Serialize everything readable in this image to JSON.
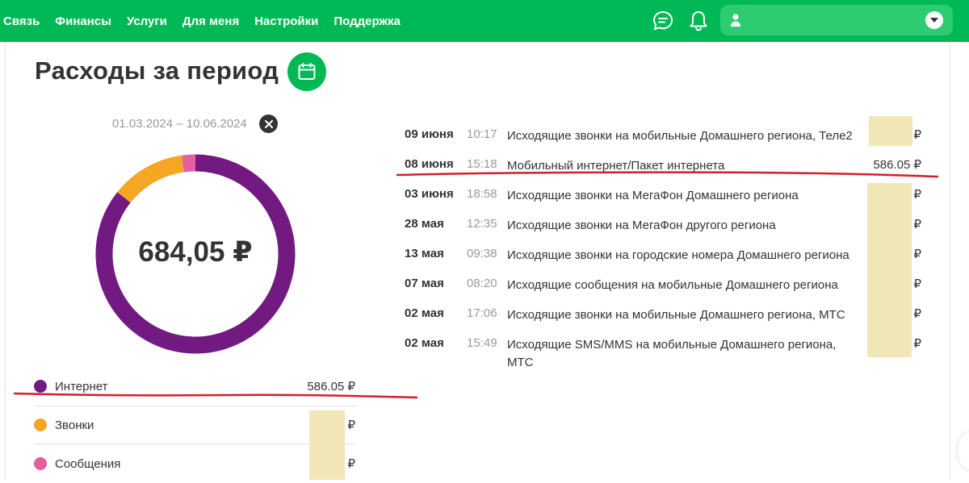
{
  "nav": {
    "items": [
      "Связь",
      "Финансы",
      "Услуги",
      "Для меня",
      "Настройки",
      "Поддержка"
    ]
  },
  "header": {
    "icons": [
      "chat-icon",
      "bell-icon",
      "user-icon",
      "chevron-down-icon"
    ]
  },
  "page": {
    "title": "Расходы за период",
    "period": "01.03.2024 – 10.06.2024"
  },
  "summary": {
    "total": "684,05 ₽",
    "legend": [
      {
        "label": "Интернет",
        "amount": "586.05 ₽",
        "color": "#731982"
      },
      {
        "label": "Звонки",
        "amount": "₽",
        "color": "#f5a623"
      },
      {
        "label": "Сообщения",
        "amount": "₽",
        "color": "#e55ea2"
      }
    ]
  },
  "chart_data": {
    "type": "pie",
    "categories": [
      "Интернет",
      "Звонки",
      "Сообщения"
    ],
    "values": [
      586.05,
      83.0,
      15.0
    ],
    "colors": [
      "#731982",
      "#f5a623",
      "#e55ea2"
    ]
  },
  "transactions": [
    {
      "date": "09 июня",
      "time": "10:17",
      "desc": "Исходящие звонки на мобильные Домашнего региона, Теле2",
      "amount": "₽"
    },
    {
      "date": "08 июня",
      "time": "15:18",
      "desc": "Мобильный интернет/Пакет интернета",
      "amount": "586.05 ₽"
    },
    {
      "date": "03 июня",
      "time": "18:58",
      "desc": "Исходящие звонки на МегаФон Домашнего региона",
      "amount": "₽"
    },
    {
      "date": "28 мая",
      "time": "12:35",
      "desc": "Исходящие звонки на МегаФон другого региона",
      "amount": "₽"
    },
    {
      "date": "13 мая",
      "time": "09:38",
      "desc": "Исходящие звонки на городские номера Домашнего региона",
      "amount": "₽"
    },
    {
      "date": "07 мая",
      "time": "08:20",
      "desc": "Исходящие сообщения на мобильные Домашнего региона",
      "amount": "₽"
    },
    {
      "date": "02 мая",
      "time": "17:06",
      "desc": "Исходящие звонки на мобильные Домашнего региона, МТС",
      "amount": "₽"
    },
    {
      "date": "02 мая",
      "time": "15:49",
      "desc": "Исходящие SMS/MMS на мобильные Домашнего региона, МТС",
      "amount": "₽"
    }
  ]
}
